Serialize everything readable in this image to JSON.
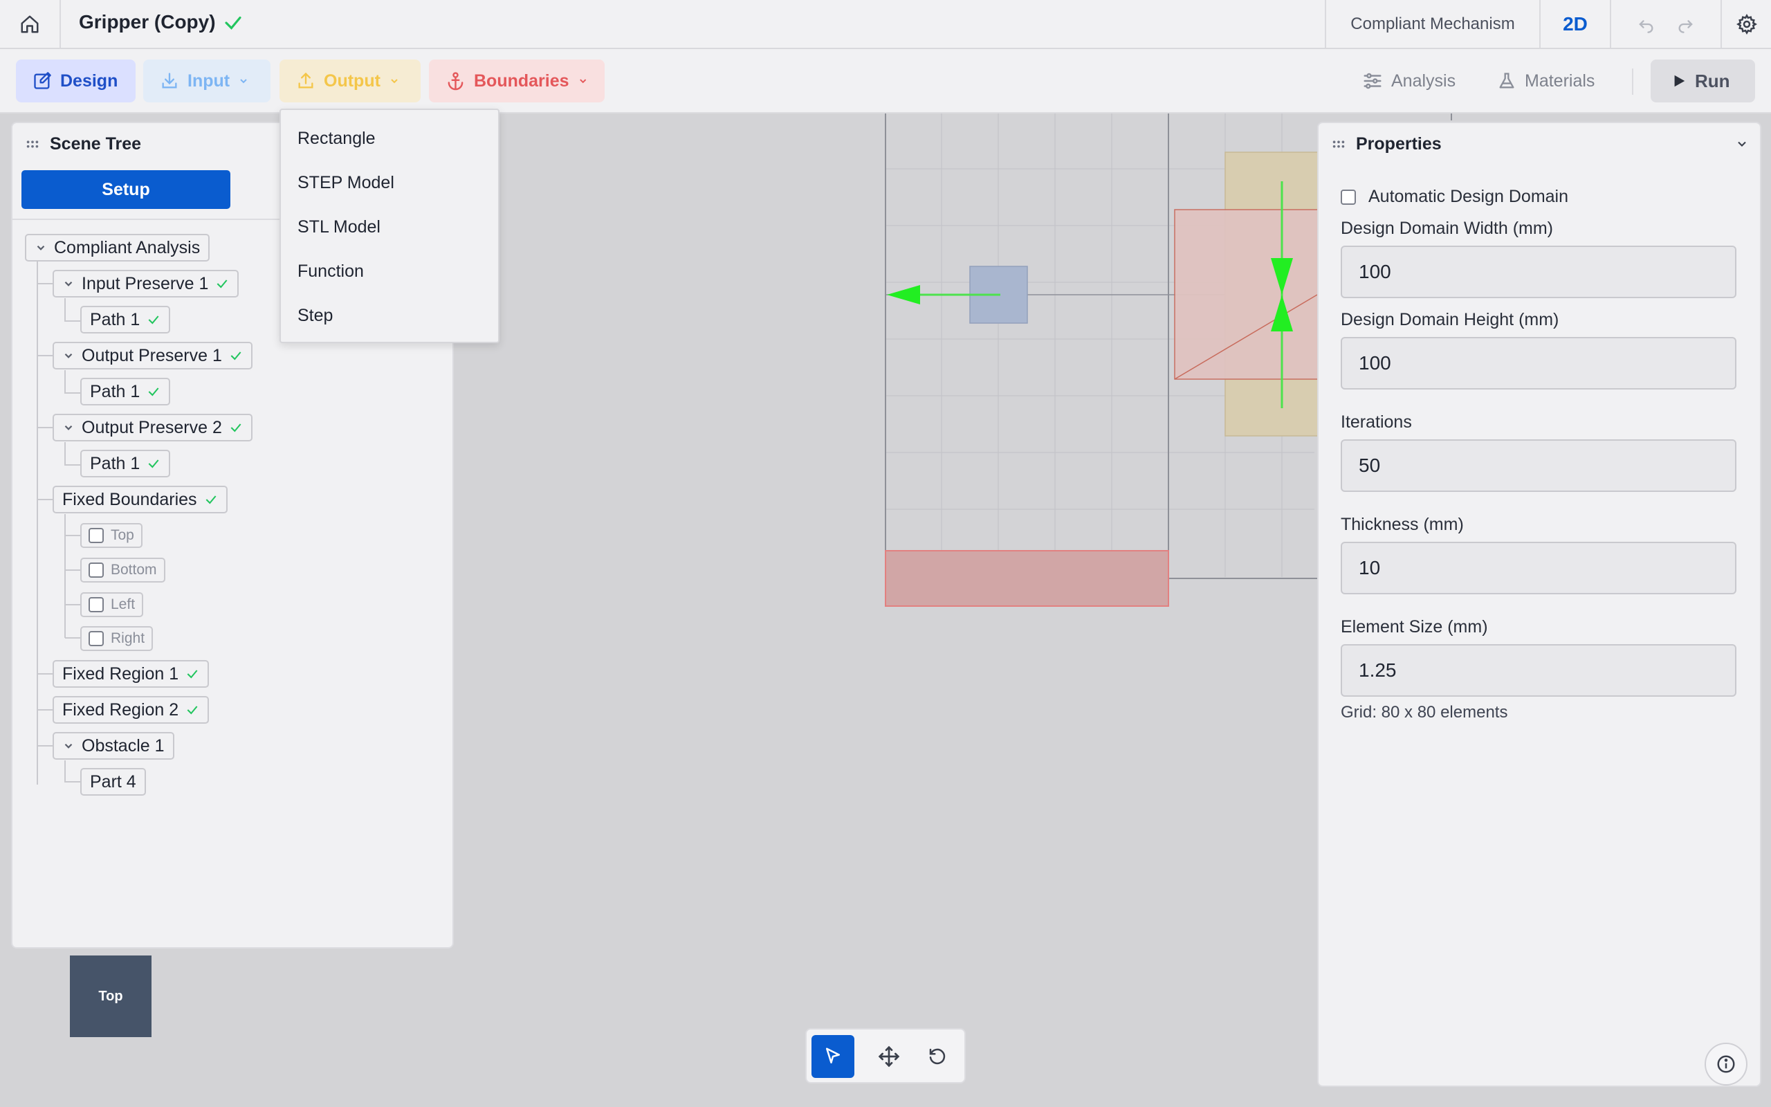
{
  "app": {
    "document_title": "Gripper (Copy)",
    "mode": "Compliant Mechanism",
    "view_dimension": "2D"
  },
  "toolbar": {
    "design_label": "Design",
    "input_label": "Input",
    "output_label": "Output",
    "boundaries_label": "Boundaries",
    "analysis_label": "Analysis",
    "materials_label": "Materials",
    "run_label": "Run"
  },
  "output_menu": {
    "items": [
      "Rectangle",
      "STEP Model",
      "STL Model",
      "Function",
      "Step"
    ]
  },
  "scene_tree": {
    "title": "Scene Tree",
    "setup_label": "Setup",
    "nodes": {
      "compliant_analysis": "Compliant Analysis",
      "input_preserve_1": "Input Preserve 1",
      "path_1": "Path 1",
      "output_preserve_1": "Output Preserve 1",
      "output_preserve_2": "Output Preserve 2",
      "fixed_boundaries": "Fixed Boundaries",
      "top": "Top",
      "bottom": "Bottom",
      "left": "Left",
      "right": "Right",
      "fixed_region_1": "Fixed Region 1",
      "fixed_region_2": "Fixed Region 2",
      "obstacle_1": "Obstacle 1",
      "part_4": "Part 4"
    }
  },
  "properties": {
    "title": "Properties",
    "auto_domain_label": "Automatic Design Domain",
    "auto_domain_checked": false,
    "width_label": "Design Domain Width (mm)",
    "width_value": "100",
    "height_label": "Design Domain Height (mm)",
    "height_value": "100",
    "iterations_label": "Iterations",
    "iterations_value": "50",
    "thickness_label": "Thickness (mm)",
    "thickness_value": "10",
    "element_size_label": "Element Size (mm)",
    "element_size_value": "1.25",
    "grid_info": "Grid: 80 x 80 elements"
  },
  "view_cube": {
    "face_label": "Top"
  },
  "colors": {
    "accent": "#0a5ccf",
    "success_check": "#22c55e",
    "input_color": "#7db5f3",
    "output_color": "#f4c64a",
    "boundary_color": "#e4575a",
    "force_arrow": "#22ee22"
  },
  "icons": [
    "home-icon",
    "check-icon",
    "undo-icon",
    "redo-icon",
    "gear-icon",
    "edit-icon",
    "download-icon",
    "upload-icon",
    "anchor-icon",
    "chevron-down-icon",
    "sliders-icon",
    "flask-icon",
    "play-icon",
    "grip-icon",
    "pointer-icon",
    "move-icon",
    "rotate-icon",
    "info-icon"
  ]
}
